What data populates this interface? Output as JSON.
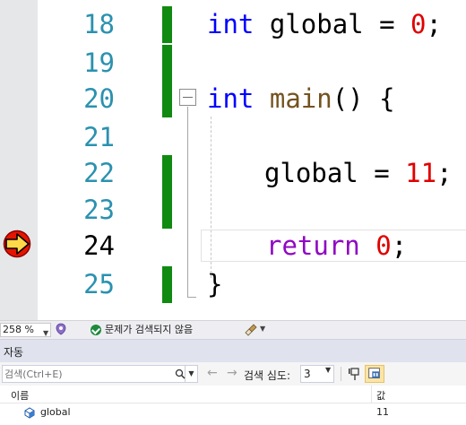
{
  "editor": {
    "lines": [
      {
        "number": "18"
      },
      {
        "number": "19"
      },
      {
        "number": "20"
      },
      {
        "number": "21"
      },
      {
        "number": "22"
      },
      {
        "number": "23"
      },
      {
        "number": "24"
      },
      {
        "number": "25"
      }
    ],
    "code": {
      "line18": {
        "kw": "int",
        "ident": " global = ",
        "num": "0",
        "end": ";"
      },
      "line20": {
        "kw": "int",
        "sp": " ",
        "fn": "main",
        "rest": "() {"
      },
      "line22": {
        "ident": "global = ",
        "num": "11",
        "end": ";"
      },
      "line24": {
        "kw": "return",
        "sp": " ",
        "num": "0",
        "end": ";"
      },
      "line25": {
        "text": "}"
      }
    },
    "current_line": "24"
  },
  "statusbar": {
    "zoom": "258 %",
    "issues": "문제가 검색되지 않음"
  },
  "autos": {
    "title": "자동",
    "search_placeholder": "검색(Ctrl+E)",
    "depth_label": "검색 심도:",
    "depth_value": "3",
    "columns": {
      "name": "이름",
      "value": "값"
    },
    "rows": [
      {
        "name": "global",
        "value": "11"
      }
    ]
  },
  "colors": {
    "change_bar": "#108a10",
    "keyword": "#0000ff",
    "flow_keyword": "#8f08c4",
    "number": "#e00000",
    "line_number": "#2b91af",
    "margin": "#e6e7e8"
  }
}
